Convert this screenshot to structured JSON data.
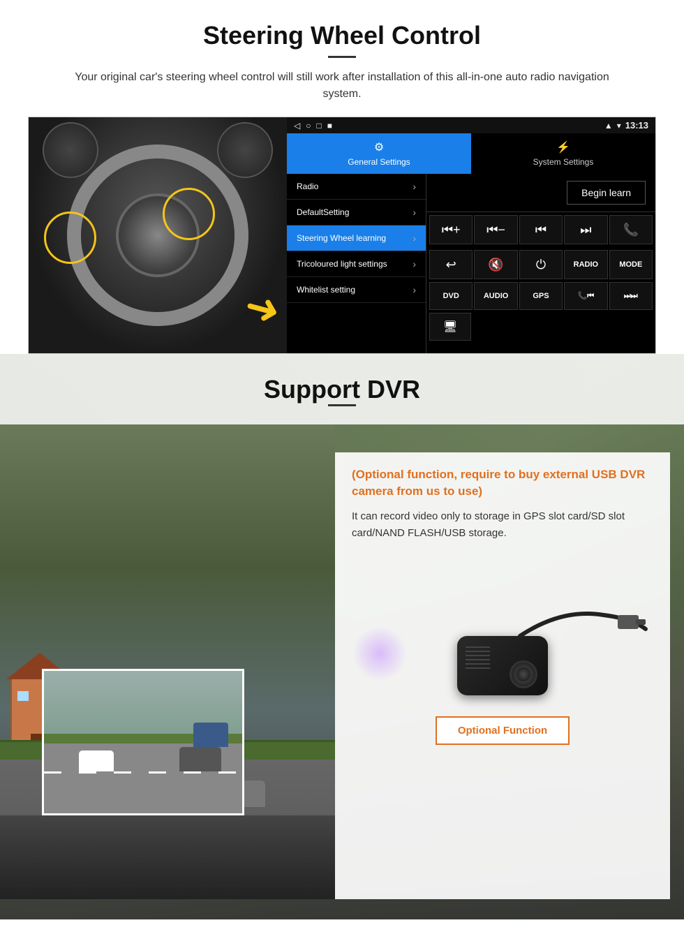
{
  "section1": {
    "title": "Steering Wheel Control",
    "description": "Your original car's steering wheel control will still work after installation of this all-in-one auto radio navigation system.",
    "ui": {
      "topbar": {
        "time": "13:13",
        "nav_icons": [
          "◁",
          "○",
          "□",
          "■"
        ]
      },
      "tabs": [
        {
          "id": "general",
          "icon": "⚙",
          "label": "General Settings",
          "active": true
        },
        {
          "id": "system",
          "icon": "⚡",
          "label": "System Settings",
          "active": false
        }
      ],
      "menu_items": [
        {
          "label": "Radio",
          "active": false
        },
        {
          "label": "DefaultSetting",
          "active": false
        },
        {
          "label": "Steering Wheel learning",
          "active": true
        },
        {
          "label": "Tricoloured light settings",
          "active": false
        },
        {
          "label": "Whitelist setting",
          "active": false
        }
      ],
      "begin_learn": "Begin learn",
      "control_buttons_row1": [
        "⏮+",
        "⏮−",
        "⏮|",
        "|⏭",
        "📞"
      ],
      "control_buttons_row2": [
        "↩",
        "🔇",
        "⏻",
        "RADIO",
        "MODE"
      ],
      "control_buttons_row3": [
        "DVD",
        "AUDIO",
        "GPS",
        "📞⏮|",
        "⏭⏭"
      ],
      "extra_button": "🖥"
    }
  },
  "section2": {
    "title": "Support DVR",
    "info_title": "(Optional function, require to buy external USB DVR camera from us to use)",
    "info_text": "It can record video only to storage in GPS slot card/SD slot card/NAND FLASH/USB storage.",
    "optional_btn": "Optional Function"
  }
}
